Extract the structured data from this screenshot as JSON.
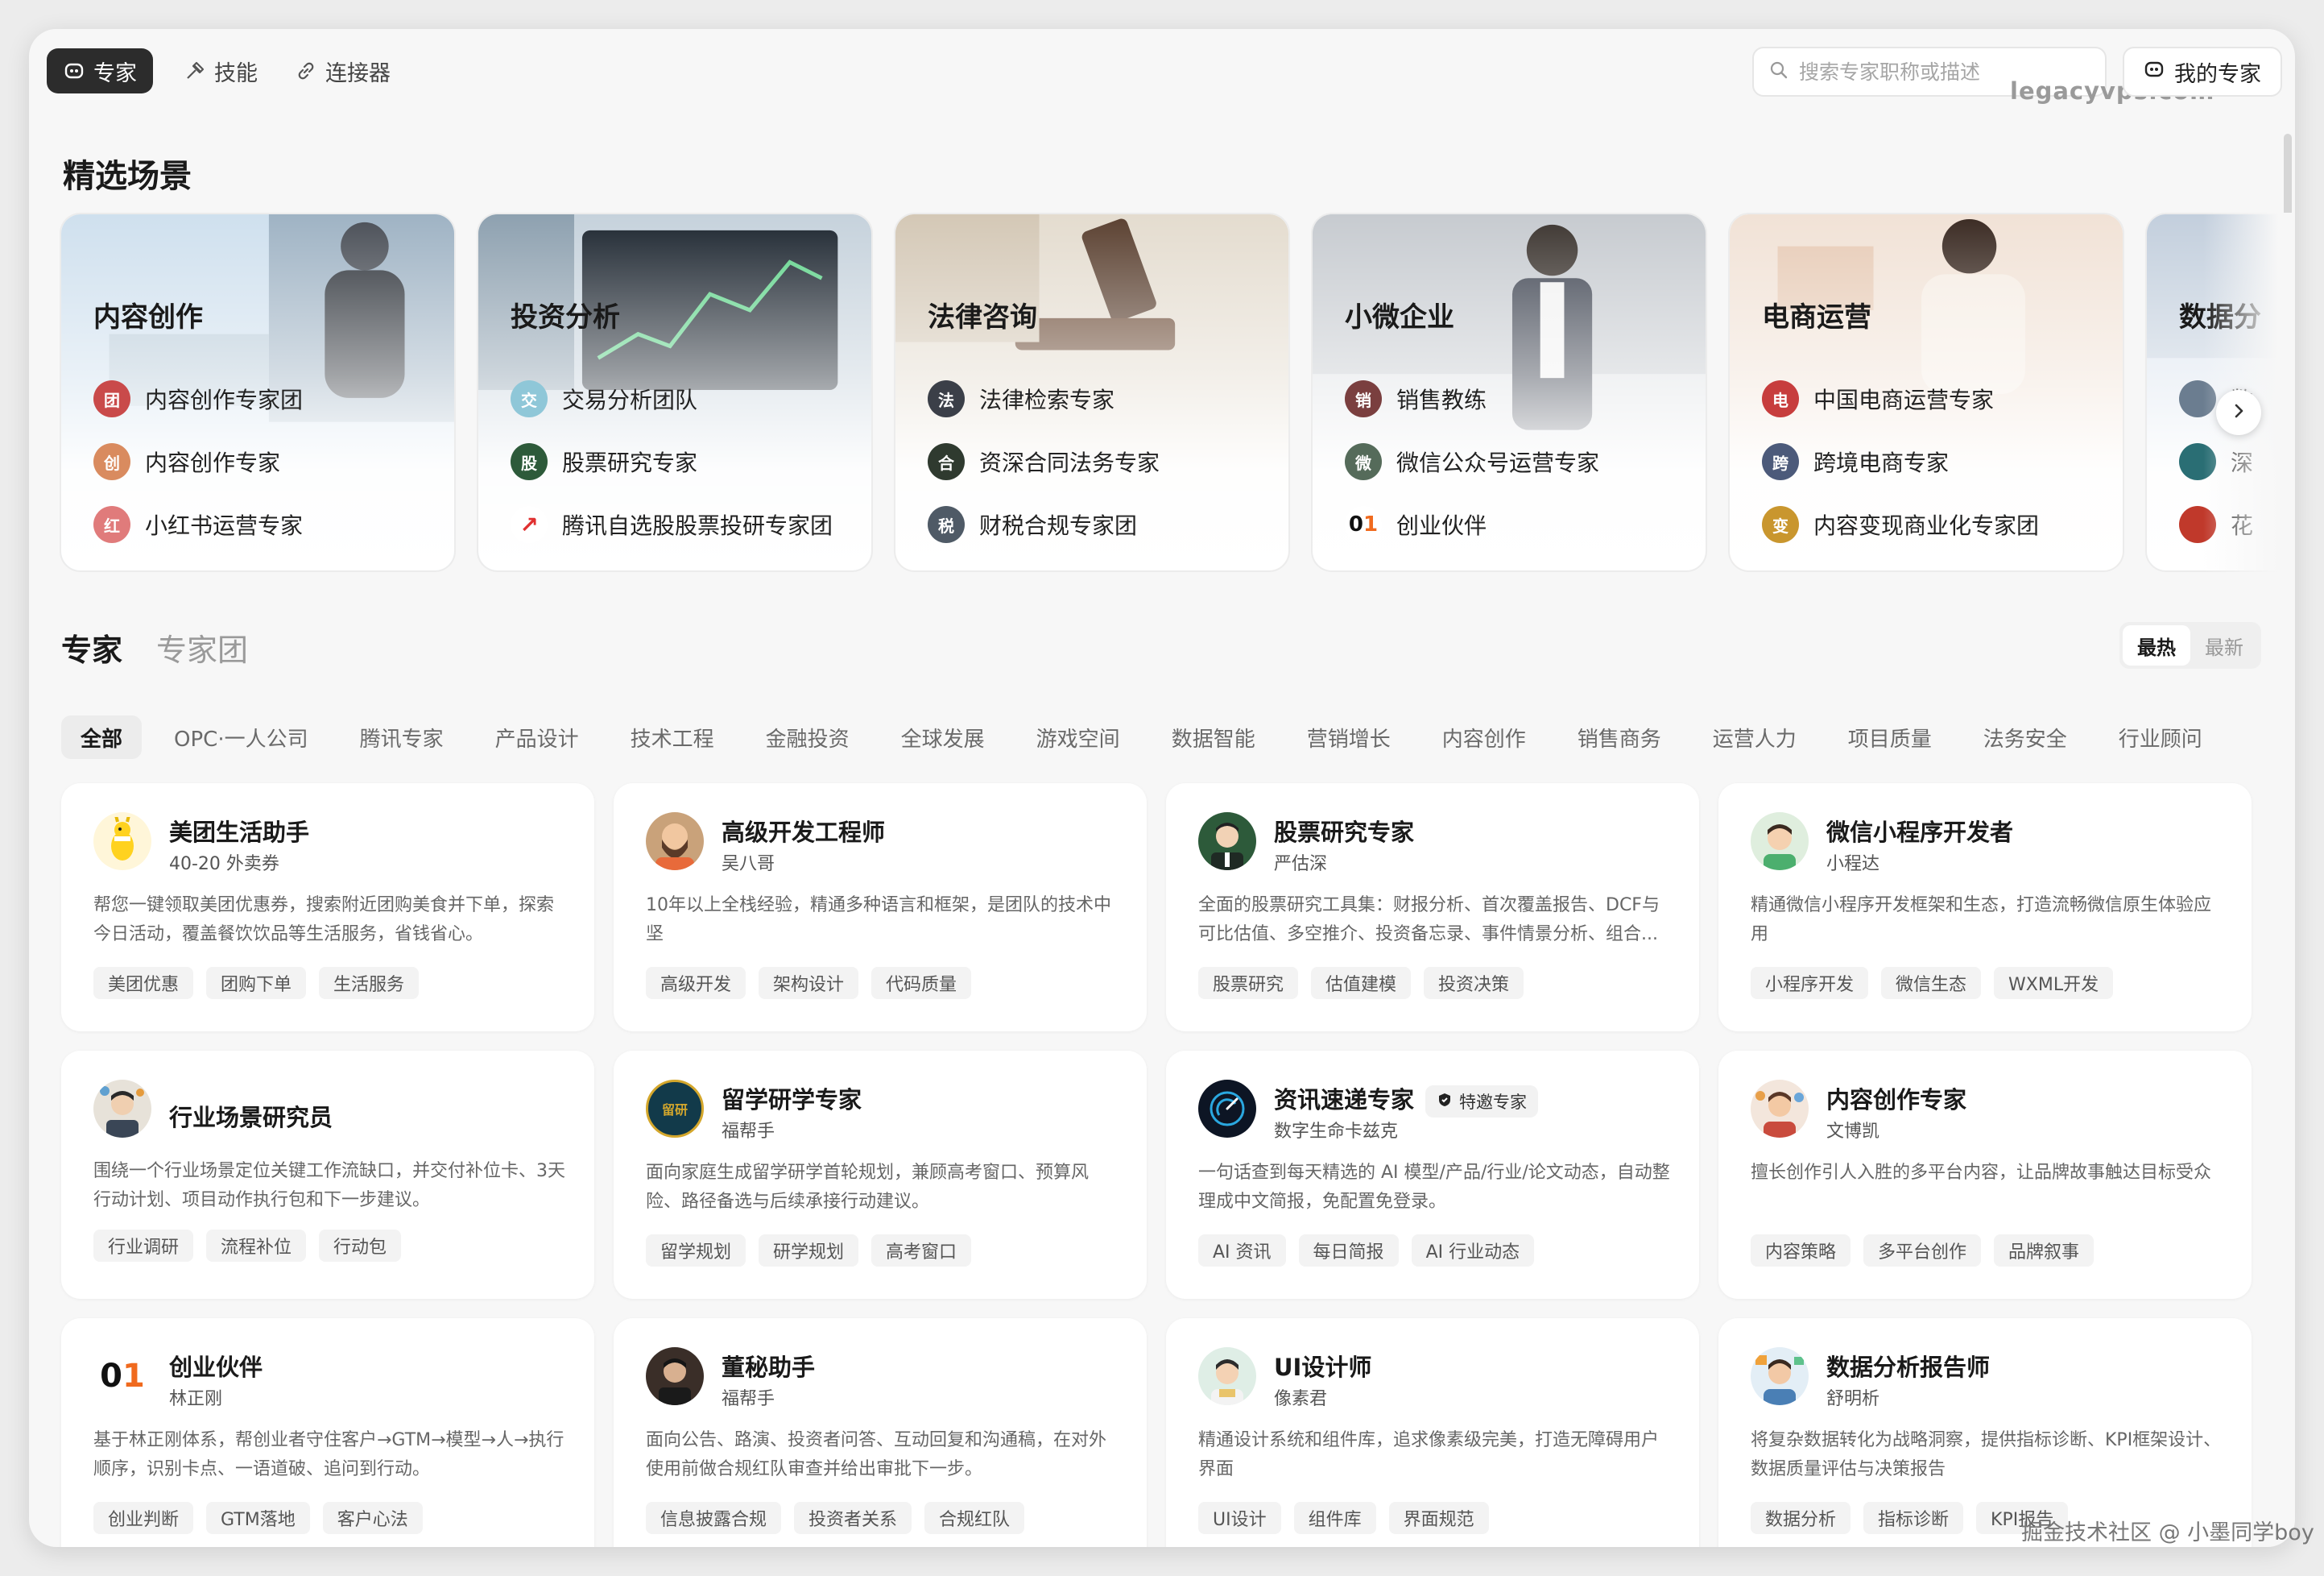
{
  "nav": {
    "tabs": [
      {
        "label": "专家",
        "icon": "expert-icon",
        "active": true
      },
      {
        "label": "技能",
        "icon": "skill-icon",
        "active": false
      },
      {
        "label": "连接器",
        "icon": "link-icon",
        "active": false
      }
    ],
    "search_placeholder": "搜索专家职称或描述",
    "my_experts": "我的专家",
    "watermark": "legacyvps.com"
  },
  "featured": {
    "title": "精选场景",
    "scenes": [
      {
        "title": "内容创作",
        "items": [
          "内容创作专家团",
          "内容创作专家",
          "小红书运营专家"
        ]
      },
      {
        "title": "投资分析",
        "items": [
          "交易分析团队",
          "股票研究专家",
          "腾讯自选股股票投研专家团"
        ]
      },
      {
        "title": "法律咨询",
        "items": [
          "法律检索专家",
          "资深合同法务专家",
          "财税合规专家团"
        ]
      },
      {
        "title": "小微企业",
        "items": [
          "销售教练",
          "微信公众号运营专家",
          "创业伙伴"
        ]
      },
      {
        "title": "电商运营",
        "items": [
          "中国电商运营专家",
          "跨境电商专家",
          "内容变现商业化专家团"
        ]
      },
      {
        "title": "数据分",
        "items": [
          "数",
          "深",
          "花"
        ]
      }
    ]
  },
  "experts": {
    "tabs": [
      "专家",
      "专家团"
    ],
    "sort": [
      "最热",
      "最新"
    ],
    "categories": [
      "全部",
      "OPC·一人公司",
      "腾讯专家",
      "产品设计",
      "技术工程",
      "金融投资",
      "全球发展",
      "游戏空间",
      "数据智能",
      "营销增长",
      "内容创作",
      "销售商务",
      "运营人力",
      "项目质量",
      "法务安全",
      "行业顾问"
    ],
    "cards": [
      {
        "name": "美团生活助手",
        "sub": "40-20 外卖券",
        "desc": "帮您一键领取美团优惠券，搜索附近团购美食并下单，探索今日活动，覆盖餐饮饮品等生活服务，省钱省心。",
        "tags": [
          "美团优惠",
          "团购下单",
          "生活服务"
        ]
      },
      {
        "name": "高级开发工程师",
        "sub": "吴八哥",
        "desc": "10年以上全栈经验，精通多种语言和框架，是团队的技术中坚",
        "tags": [
          "高级开发",
          "架构设计",
          "代码质量"
        ]
      },
      {
        "name": "股票研究专家",
        "sub": "严估深",
        "desc": "全面的股票研究工具集：财报分析、首次覆盖报告、DCF与可比估值、多空推介、投资备忘录、事件情景分析、组合...",
        "tags": [
          "股票研究",
          "估值建模",
          "投资决策"
        ]
      },
      {
        "name": "微信小程序开发者",
        "sub": "小程达",
        "desc": "精通微信小程序开发框架和生态，打造流畅微信原生体验应用",
        "tags": [
          "小程序开发",
          "微信生态",
          "WXML开发"
        ]
      },
      {
        "name": "行业场景研究员",
        "sub": "",
        "desc": "围绕一个行业场景定位关键工作流缺口，并交付补位卡、3天行动计划、项目动作执行包和下一步建议。",
        "tags": [
          "行业调研",
          "流程补位",
          "行动包"
        ]
      },
      {
        "name": "留学研学专家",
        "sub": "福帮手",
        "desc": "面向家庭生成留学研学首轮规划，兼顾高考窗口、预算风险、路径备选与后续承接行动建议。",
        "tags": [
          "留学规划",
          "研学规划",
          "高考窗口"
        ]
      },
      {
        "name": "资讯速递专家",
        "sub": "数字生命卡兹克",
        "badge": "特邀专家",
        "desc": "一句话查到每天精选的 AI 模型/产品/行业/论文动态，自动整理成中文简报，免配置免登录。",
        "tags": [
          "AI 资讯",
          "每日简报",
          "AI 行业动态"
        ]
      },
      {
        "name": "内容创作专家",
        "sub": "文博凯",
        "desc": "擅长创作引人入胜的多平台内容，让品牌故事触达目标受众",
        "tags": [
          "内容策略",
          "多平台创作",
          "品牌叙事"
        ]
      },
      {
        "name": "创业伙伴",
        "sub": "林正刚",
        "desc": "基于林正刚体系，帮创业者守住客户→GTM→模型→人→执行顺序，识别卡点、一语道破、追问到行动。",
        "tags": [
          "创业判断",
          "GTM落地",
          "客户心法"
        ]
      },
      {
        "name": "董秘助手",
        "sub": "福帮手",
        "desc": "面向公告、路演、投资者问答、互动回复和沟通稿，在对外使用前做合规红队审查并给出审批下一步。",
        "tags": [
          "信息披露合规",
          "投资者关系",
          "合规红队"
        ]
      },
      {
        "name": "UI设计师",
        "sub": "像素君",
        "desc": "精通设计系统和组件库，追求像素级完美，打造无障碍用户界面",
        "tags": [
          "UI设计",
          "组件库",
          "界面规范"
        ]
      },
      {
        "name": "数据分析报告师",
        "sub": "舒明析",
        "desc": "将复杂数据转化为战略洞察，提供指标诊断、KPI框架设计、数据质量评估与决策报告",
        "tags": [
          "数据分析",
          "指标诊断",
          "KPI报告"
        ]
      }
    ]
  },
  "footer_watermark": "掘金技术社区 @ 小墨同学boy",
  "colors": {
    "accent_dark": "#2c2c2c",
    "card_bg": "#ffffff",
    "page_bg": "#f7f7f7"
  }
}
